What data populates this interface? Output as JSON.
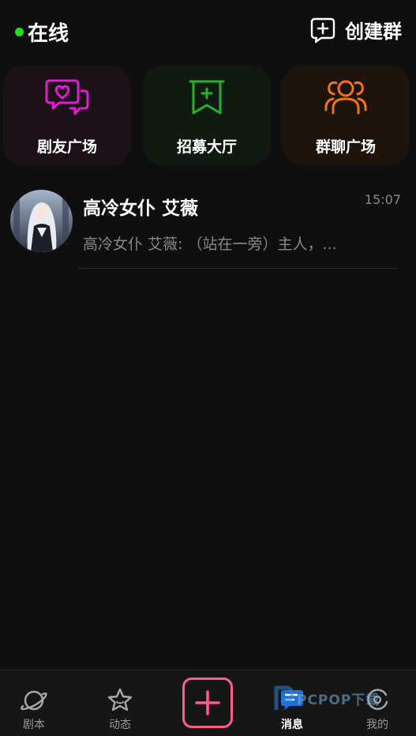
{
  "header": {
    "status_text": "在线",
    "status_color": "#22e01a",
    "create_group_label": "创建群",
    "create_group_icon": "plus-square-icon"
  },
  "cards": [
    {
      "label": "剧友广场",
      "icon": "heart-chat-icon",
      "color": "#e21bd6"
    },
    {
      "label": "招募大厅",
      "icon": "bookmark-plus-icon",
      "color": "#25b22a"
    },
    {
      "label": "群聊广场",
      "icon": "users-group-icon",
      "color": "#f2731d"
    }
  ],
  "chats": [
    {
      "name": "高冷女仆 艾薇",
      "time": "15:07",
      "preview": "高冷女仆 艾薇: （站在一旁）主人，...",
      "avatar": "maid-avatar"
    }
  ],
  "tabbar": {
    "tabs": [
      {
        "label": "剧本",
        "icon": "planet-icon"
      },
      {
        "label": "动态",
        "icon": "star-icon"
      },
      {
        "label": "消息",
        "icon": "message-icon",
        "active": true
      },
      {
        "label": "我的",
        "icon": "profile-icon"
      }
    ],
    "add_icon": "plus-icon",
    "add_color": "#ff5d8a"
  },
  "watermark": {
    "text": "PCPOP下载"
  }
}
